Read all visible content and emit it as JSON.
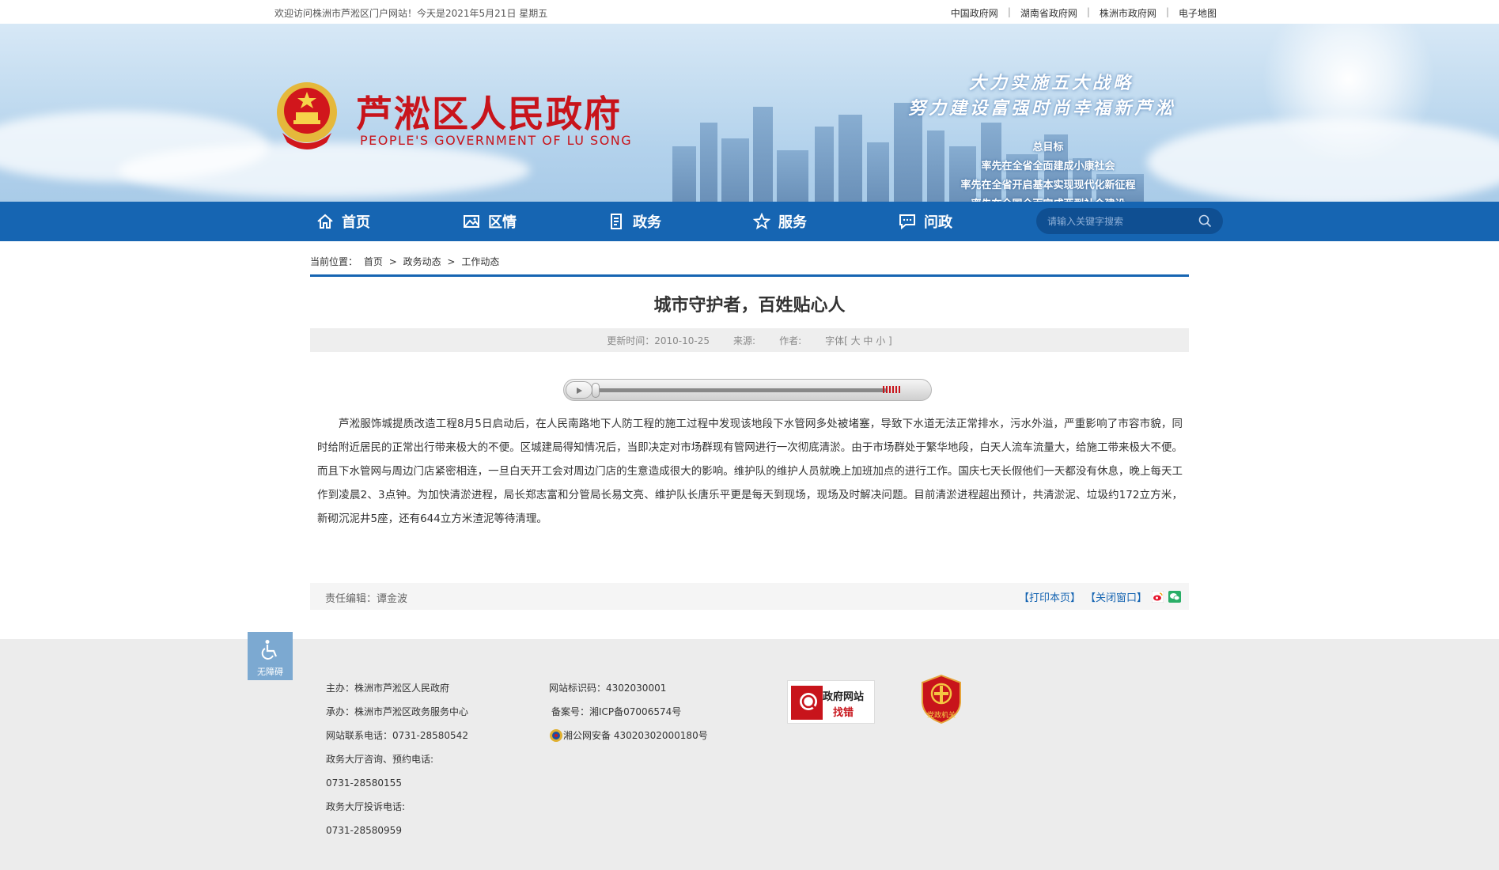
{
  "topbar": {
    "welcome": "欢迎访问株洲市芦淞区门户网站！今天是2021年5月21日 星期五",
    "links": [
      "中国政府网",
      "湖南省政府网",
      "株洲市政府网",
      "电子地图"
    ],
    "separator": "|"
  },
  "banner": {
    "site_title": "芦淞区人民政府",
    "site_subtitle": "PEOPLE'S GOVERNMENT OF  LU SONG",
    "slogan_line1": "大力实施五大战略",
    "slogan_line2": "努力建设富强时尚幸福新芦淞",
    "goal_heading": "总目标",
    "goal_line1": "率先在全省全面建成小康社会",
    "goal_line2": "率先在全省开启基本实现现代化新征程",
    "goal_line3": "率先在全国全面完成两型社会建设"
  },
  "nav": {
    "items": [
      {
        "label": "首页",
        "icon": "home-icon"
      },
      {
        "label": "区情",
        "icon": "image-icon"
      },
      {
        "label": "政务",
        "icon": "document-icon"
      },
      {
        "label": "服务",
        "icon": "star-icon"
      },
      {
        "label": "问政",
        "icon": "chat-icon"
      }
    ],
    "search_placeholder": "请输入关键字搜索",
    "search_icon": "search-icon"
  },
  "breadcrumb": {
    "prefix": "当前位置：",
    "items": [
      "首页",
      "政务动态",
      "工作动态"
    ],
    "separator": ">"
  },
  "article": {
    "title": "城市守护者，百姓贴心人",
    "updated_label": "更新时间：2010-10-25",
    "source_label": "来源:",
    "author_label": "作者:",
    "font_size_label": "字体[ 大 中 小 ]",
    "body": "芦淞服饰城提质改造工程8月5日启动后，在人民南路地下人防工程的施工过程中发现该地段下水管网多处被堵塞，导致下水道无法正常排水，污水外溢，严重影响了市容市貌，同时给附近居民的正常出行带来极大的不便。区城建局得知情况后，当即决定对市场群现有管网进行一次彻底清淤。由于市场群处于繁华地段，白天人流车流量大，给施工带来极大不便。而且下水管网与周边门店紧密相连，一旦白天开工会对周边门店的生意造成很大的影响。维护队的维护人员就晚上加班加点的进行工作。国庆七天长假他们一天都没有休息，晚上每天工作到凌晨2、3点钟。为加快清淤进程，局长郑志富和分管局长易文亮、维护队长唐乐平更是每天到现场，现场及时解决问题。目前清淤进程超出预计，共清淤泥、垃圾约172立方米，新砌沉泥井5座，还有644立方米渣泥等待清理。",
    "editor_label": "责任编辑：谭金波",
    "print_label": "【打印本页】",
    "close_label": "【关闭窗口】",
    "share_icons": [
      "weibo-icon",
      "wechat-icon"
    ]
  },
  "footer": {
    "accessibility_label": "无障碍",
    "col1": [
      "主办：株洲市芦淞区人民政府",
      "承办：株洲市芦淞区政务服务中心",
      "网站联系电话：0731-28580542",
      "政务大厅咨询、预约电话:",
      "0731-28580155",
      "政务大厅投诉电话:",
      "0731-28580959"
    ],
    "col2": [
      "网站标识码：4302030001",
      "备案号：湘ICP备07006574号",
      "湘公网安备 43020302000180号"
    ],
    "zhaocuo_line1": "政府网站",
    "zhaocuo_line2": "找错",
    "dangzheng_label": "党政机关"
  },
  "colors": {
    "brand_red": "#c8141b",
    "nav_blue": "#1665b2",
    "footer_gray": "#ececec"
  }
}
